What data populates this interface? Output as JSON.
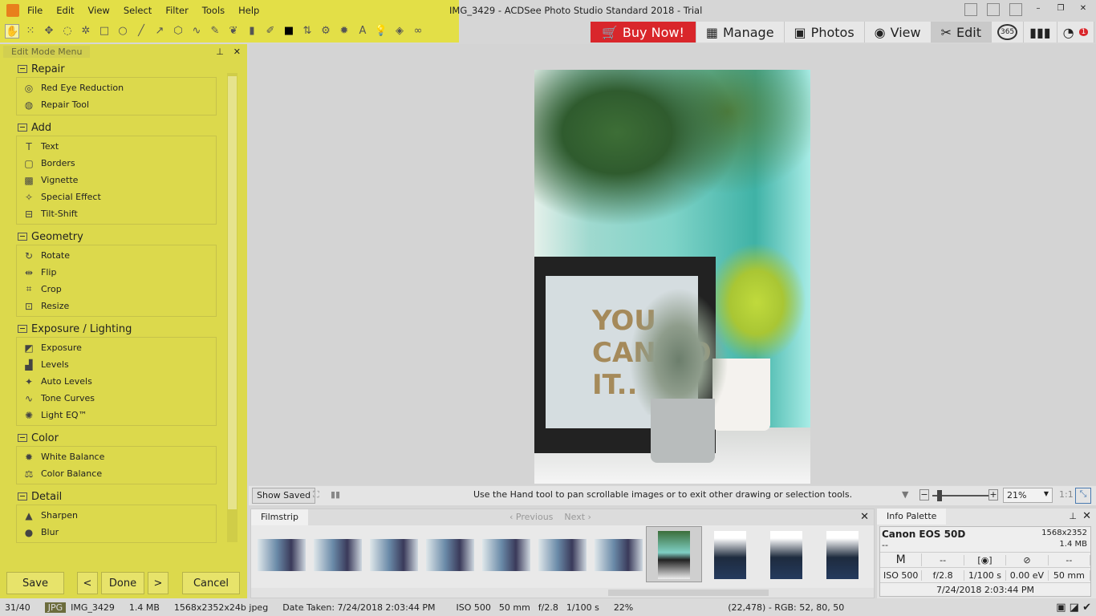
{
  "app": {
    "title": "IMG_3429 - ACDSee Photo Studio Standard 2018 - Trial"
  },
  "menu": [
    "File",
    "Edit",
    "View",
    "Select",
    "Filter",
    "Tools",
    "Help"
  ],
  "toolbar_icons": [
    "hand-icon",
    "marquee-icon",
    "move-icon",
    "lasso-icon",
    "magic-wand-icon",
    "rectangle-icon",
    "ellipse-icon",
    "line-icon",
    "arrow-icon",
    "polygon-icon",
    "curve-icon",
    "brush-icon",
    "smudge-icon",
    "gradient-icon",
    "eyedropper-icon",
    "color-swatch-icon",
    "dodge-icon",
    "gear-icon",
    "text-icon",
    "bulb-icon",
    "fill-icon",
    "binoculars-icon"
  ],
  "modes": {
    "buy": "Buy Now!",
    "manage": "Manage",
    "photos": "Photos",
    "view": "View",
    "edit": "Edit",
    "badge": "365",
    "notif": "1"
  },
  "colors": {
    "panel": "#dcd94c",
    "buy": "#d9262b"
  },
  "left_panel": {
    "title": "Edit Mode Menu",
    "groups": [
      {
        "label": "Repair",
        "items": [
          "Red Eye Reduction",
          "Repair Tool"
        ]
      },
      {
        "label": "Add",
        "items": [
          "Text",
          "Borders",
          "Vignette",
          "Special Effect",
          "Tilt-Shift"
        ]
      },
      {
        "label": "Geometry",
        "items": [
          "Rotate",
          "Flip",
          "Crop",
          "Resize"
        ]
      },
      {
        "label": "Exposure / Lighting",
        "items": [
          "Exposure",
          "Levels",
          "Auto Levels",
          "Tone Curves",
          "Light EQ™"
        ]
      },
      {
        "label": "Color",
        "items": [
          "White Balance",
          "Color Balance"
        ]
      },
      {
        "label": "Detail",
        "items": [
          "Sharpen",
          "Blur"
        ]
      }
    ],
    "buttons": {
      "save": "Save",
      "prev": "<",
      "done": "Done",
      "next": ">",
      "cancel": "Cancel"
    }
  },
  "photo": {
    "text": "YOU CAN DO IT.."
  },
  "viewer_bar": {
    "show_saved": "Show Saved",
    "hint": "Use the Hand tool to pan scrollable images or to exit other drawing or selection tools.",
    "zoom": "21%",
    "one_to_one": "1:1"
  },
  "filmstrip": {
    "title": "Filmstrip",
    "previous": "Previous",
    "next": "Next"
  },
  "info": {
    "title": "Info Palette",
    "camera": "Canon EOS 50D",
    "lens": "--",
    "dims": "1568x2352",
    "size": "1.4 MB",
    "row1": [
      "M",
      "--",
      "",
      "",
      "--"
    ],
    "row2": [
      "ISO 500",
      "f/2.8",
      "1/100 s",
      "0.00 eV",
      "50 mm"
    ],
    "date": "7/24/2018 2:03:44 PM"
  },
  "status": {
    "index": "31/40",
    "type": "JPG",
    "name": "IMG_3429",
    "size": "1.4 MB",
    "format": "1568x2352x24b jpeg",
    "date": "Date Taken: 7/24/2018 2:03:44 PM",
    "iso": "ISO 500",
    "focal": "50 mm",
    "aperture": "f/2.8",
    "shutter": "1/100 s",
    "zoom": "22%",
    "pixel": "(22,478) - RGB: 52, 80, 50"
  }
}
